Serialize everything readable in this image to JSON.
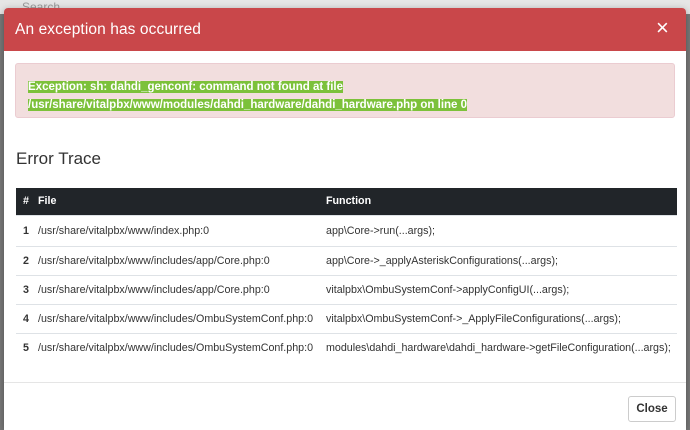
{
  "background": {
    "search_placeholder": "Search"
  },
  "modal": {
    "title": "An exception has occurred",
    "close_icon": "close-icon",
    "exception_message": "Exception: sh: dahdi_genconf: command not found at file /usr/share/vitalpbx/www/modules/dahdi_hardware/dahdi_hardware.php on line 0",
    "trace_heading": "Error Trace",
    "columns": {
      "num": "#",
      "file": "File",
      "function": "Function"
    },
    "rows": [
      {
        "num": "1",
        "file": "/usr/share/vitalpbx/www/index.php:0",
        "function": "app\\Core->run(...args);"
      },
      {
        "num": "2",
        "file": "/usr/share/vitalpbx/www/includes/app/Core.php:0",
        "function": "app\\Core->_applyAsteriskConfigurations(...args);"
      },
      {
        "num": "3",
        "file": "/usr/share/vitalpbx/www/includes/app/Core.php:0",
        "function": "vitalpbx\\OmbuSystemConf->applyConfigUI(...args);"
      },
      {
        "num": "4",
        "file": "/usr/share/vitalpbx/www/includes/OmbuSystemConf.php:0",
        "function": "vitalpbx\\OmbuSystemConf->_ApplyFileConfigurations(...args);"
      },
      {
        "num": "5",
        "file": "/usr/share/vitalpbx/www/includes/OmbuSystemConf.php:0",
        "function": "modules\\dahdi_hardware\\dahdi_hardware->getFileConfiguration(...args);"
      }
    ],
    "close_label": "Close"
  },
  "colors": {
    "header": "#c9474a",
    "alert_bg": "#f2dede",
    "highlight": "#7cc13a",
    "table_header": "#212529"
  }
}
